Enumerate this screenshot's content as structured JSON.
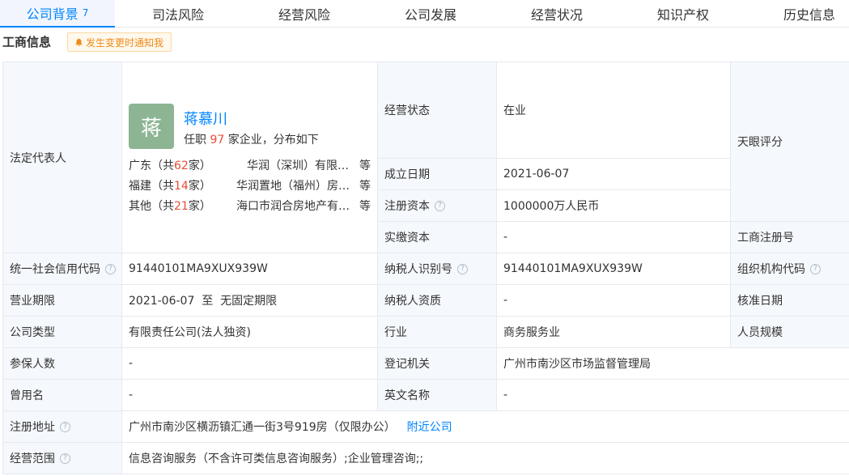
{
  "tabs": [
    {
      "label": "公司背景",
      "count": "7"
    },
    {
      "label": "司法风险"
    },
    {
      "label": "经营风险"
    },
    {
      "label": "公司发展"
    },
    {
      "label": "经营状况"
    },
    {
      "label": "知识产权"
    },
    {
      "label": "历史信息"
    }
  ],
  "section": {
    "title": "工商信息",
    "notify_label": "发生变更时通知我"
  },
  "legal_rep": {
    "label": "法定代表人",
    "avatar_char": "蒋",
    "name": "蒋慕川",
    "sub_prefix": "任职",
    "sub_count": "97",
    "sub_suffix": "家企业，分布如下",
    "distribution": [
      {
        "region_prefix": "广东（共",
        "count": "62",
        "region_suffix": "家）",
        "company": "华润（深圳）有限公司",
        "suffix": "等"
      },
      {
        "region_prefix": "福建（共",
        "count": "14",
        "region_suffix": "家）",
        "company": "华润置地（福州）房地产有限公司",
        "suffix": "等"
      },
      {
        "region_prefix": "其他（共",
        "count": "21",
        "region_suffix": "家）",
        "company": "海口市润合房地产有限公司",
        "suffix": "等"
      }
    ]
  },
  "fields": {
    "status_label": "经营状态",
    "status_value": "在业",
    "score_label": "天眼评分",
    "founded_label": "成立日期",
    "founded_value": "2021-06-07",
    "reg_capital_label": "注册资本",
    "reg_capital_value": "1000000万人民币",
    "paid_capital_label": "实缴资本",
    "paid_capital_value": "-",
    "biz_reg_no_label": "工商注册号",
    "credit_code_label": "统一社会信用代码",
    "credit_code_value": "91440101MA9XUX939W",
    "taxpayer_id_label": "纳税人识别号",
    "taxpayer_id_value": "91440101MA9XUX939W",
    "org_code_label": "组织机构代码",
    "term_label": "营业期限",
    "term_value": "2021-06-07  至  无固定期限",
    "taxpayer_qual_label": "纳税人资质",
    "taxpayer_qual_value": "-",
    "approval_date_label": "核准日期",
    "company_type_label": "公司类型",
    "company_type_value": "有限责任公司(法人独资)",
    "industry_label": "行业",
    "industry_value": "商务服务业",
    "staff_size_label": "人员规模",
    "insured_label": "参保人数",
    "insured_value": "-",
    "reg_authority_label": "登记机关",
    "reg_authority_value": "广州市南沙区市场监督管理局",
    "former_name_label": "曾用名",
    "former_name_value": "-",
    "english_name_label": "英文名称",
    "english_name_value": "-",
    "address_label": "注册地址",
    "address_value": "广州市南沙区横沥镇汇通一街3号919房（仅限办公）",
    "nearby_link": "附近公司",
    "scope_label": "经营范围",
    "scope_value": "信息咨询服务（不含许可类信息咨询服务）;企业管理咨询;;"
  },
  "colors": {
    "accent": "#0084ff",
    "highlight": "#e94b33",
    "label_bg": "#f5f8fc",
    "avatar_bg": "#8db594"
  }
}
